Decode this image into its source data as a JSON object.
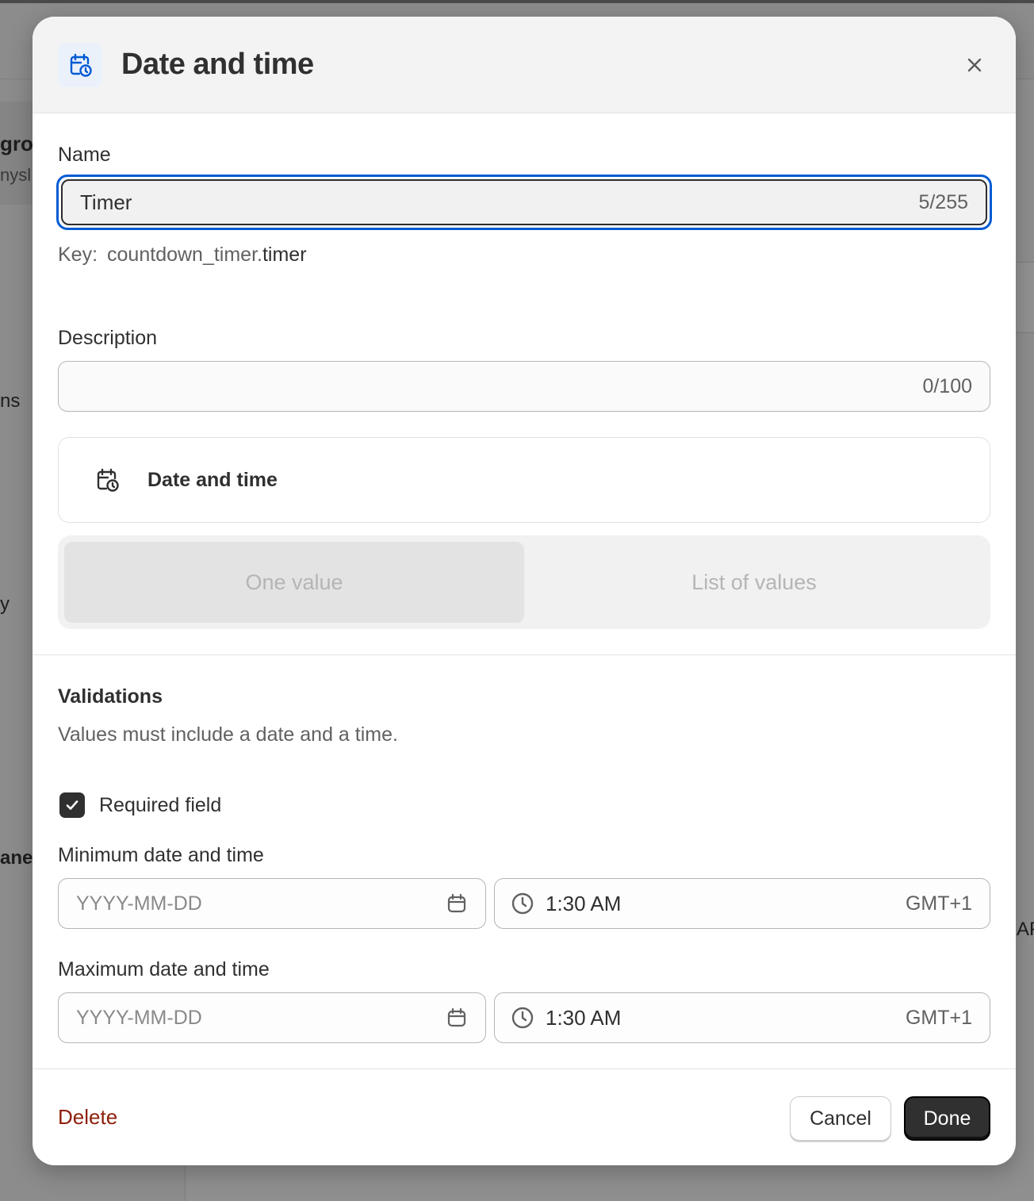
{
  "background": {
    "fragments": [
      "gro",
      "nysl",
      "ns",
      "y",
      "anel",
      "AP"
    ]
  },
  "modal": {
    "title": "Date and time",
    "header_icon": "calendar-clock-icon",
    "close_icon": "close-icon"
  },
  "name": {
    "label": "Name",
    "value": "Timer",
    "counter": "5/255"
  },
  "key": {
    "label": "Key:",
    "prefix": "countdown_timer.",
    "suffix": "timer"
  },
  "description": {
    "label": "Description",
    "value": "",
    "counter": "0/100"
  },
  "type": {
    "label": "Date and time",
    "icon": "calendar-clock-icon"
  },
  "value_mode": {
    "options": [
      "One value",
      "List of values"
    ],
    "selected": "One value"
  },
  "validations": {
    "title": "Validations",
    "description": "Values must include a date and a time.",
    "required_label": "Required field",
    "required_checked": true,
    "min": {
      "label": "Minimum date and time",
      "date_placeholder": "YYYY-MM-DD",
      "time": "1:30 AM",
      "timezone": "GMT+1"
    },
    "max": {
      "label": "Maximum date and time",
      "date_placeholder": "YYYY-MM-DD",
      "time": "1:30 AM",
      "timezone": "GMT+1"
    }
  },
  "footer": {
    "delete_label": "Delete",
    "cancel_label": "Cancel",
    "done_label": "Done"
  },
  "colors": {
    "focus_ring": "#005bd3",
    "destructive": "#8e1f0b",
    "primary_button": "#303030"
  }
}
